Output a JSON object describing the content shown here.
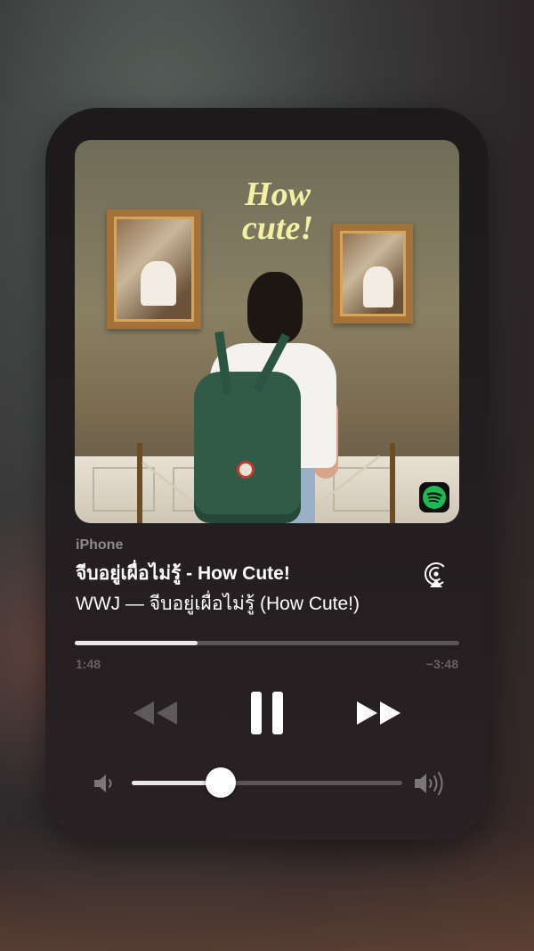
{
  "player": {
    "device": "iPhone",
    "title": "จีบอยู่เผื่อไม่รู้ - How Cute!",
    "subtitle": "WWJ — จีบอยู่เผื่อไม่รู้ (How Cute!)",
    "artwork_text": "How cute!",
    "source_icon": "spotify-icon",
    "output_icon": "airplay-icon"
  },
  "playback": {
    "elapsed": "1:48",
    "remaining": "−3:48",
    "progress_fraction": 0.32,
    "state": "playing",
    "controls": [
      "rewind-icon",
      "pause-icon",
      "fast-forward-icon"
    ]
  },
  "volume": {
    "level_fraction": 0.33,
    "low_icon": "speaker-low-icon",
    "high_icon": "speaker-high-icon"
  },
  "colors": {
    "accent": "#ffffff",
    "spotify_green": "#1db954",
    "track_inactive": "#5a5658",
    "muted_text": "#8e8a8c"
  }
}
